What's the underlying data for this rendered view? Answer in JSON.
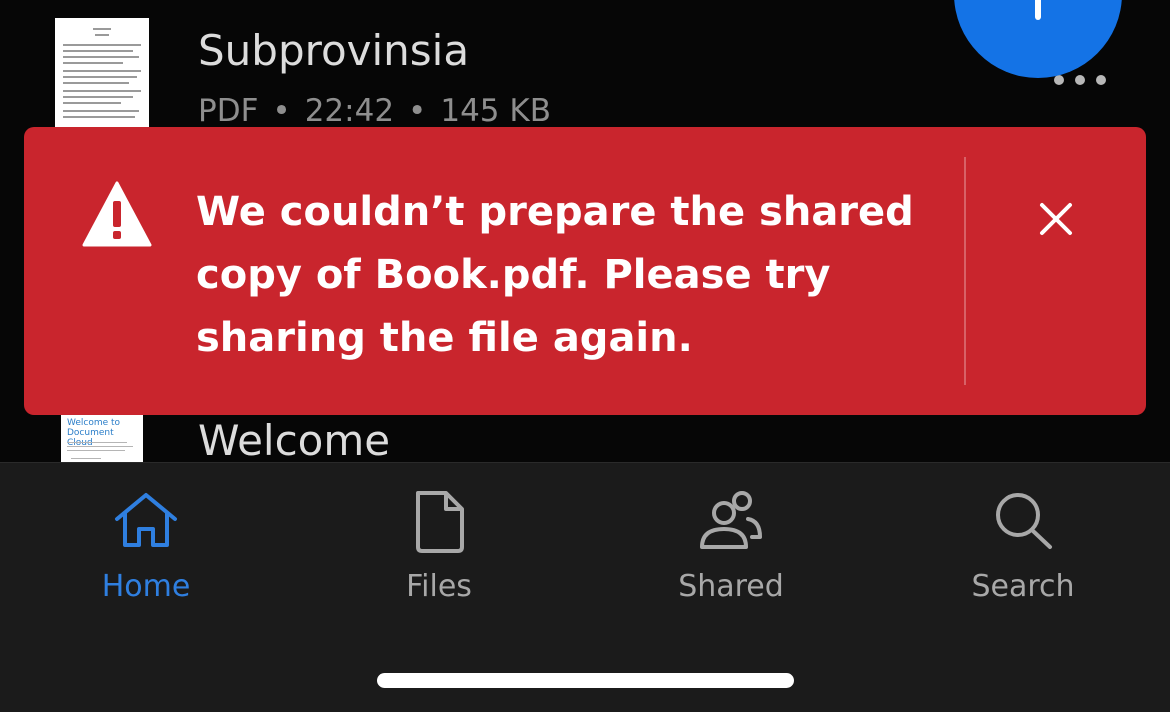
{
  "files": [
    {
      "name": "Subprovinsia",
      "type": "PDF",
      "time": "22:42",
      "size": "145 KB",
      "separator": "•"
    },
    {
      "name": "Welcome",
      "thumb_title": "Welcome to Document Cloud"
    }
  ],
  "fab": {
    "icon": "plus-icon"
  },
  "more": {
    "icon": "more-horizontal-icon"
  },
  "toast": {
    "message": "We couldn’t prepare the shared copy of Book.pdf. Please try sharing the file again.",
    "icon": "warning-icon",
    "close_icon": "close-icon",
    "color": "#c9252d"
  },
  "tabs": [
    {
      "label": "Home",
      "icon": "home-icon",
      "active": true
    },
    {
      "label": "Files",
      "icon": "file-icon",
      "active": false
    },
    {
      "label": "Shared",
      "icon": "people-icon",
      "active": false
    },
    {
      "label": "Search",
      "icon": "search-icon",
      "active": false
    }
  ],
  "colors": {
    "accent": "#2f7fe0",
    "fab": "#1473e6",
    "toast_bg": "#c9252d",
    "tabbar_bg": "#1b1b1b"
  }
}
